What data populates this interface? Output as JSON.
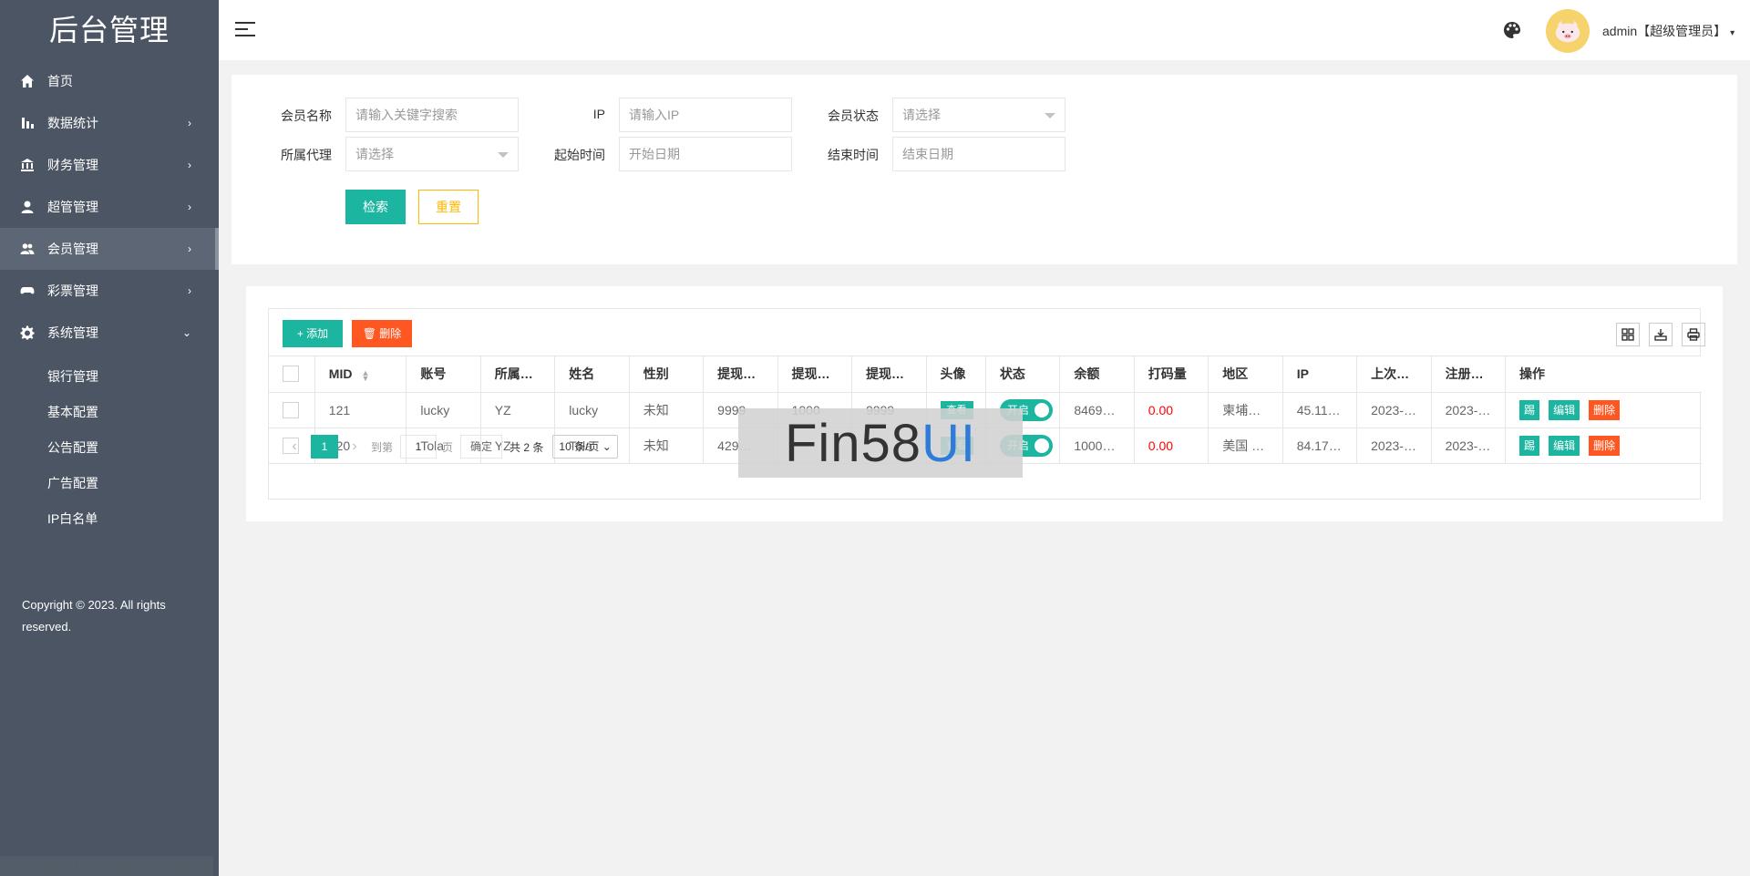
{
  "sidebar": {
    "title": "后台管理",
    "items": [
      {
        "label": "首页",
        "icon": "home-icon",
        "arrow": ""
      },
      {
        "label": "数据统计",
        "icon": "bar-chart-icon",
        "arrow": "›"
      },
      {
        "label": "财务管理",
        "icon": "bank-icon",
        "arrow": "›"
      },
      {
        "label": "超管管理",
        "icon": "user-icon",
        "arrow": "›"
      },
      {
        "label": "会员管理",
        "icon": "users-icon",
        "arrow": "›"
      },
      {
        "label": "彩票管理",
        "icon": "gamepad-icon",
        "arrow": "›"
      },
      {
        "label": "系统管理",
        "icon": "gear-icon",
        "arrow": "⌄"
      }
    ],
    "sub_items": [
      "银行管理",
      "基本配置",
      "公告配置",
      "广告配置",
      "IP白名单"
    ],
    "copyright": "Copyright © 2023. All rights reserved.",
    "status_url": "admincaperends.com/admin/homes/index"
  },
  "header": {
    "user": "admin【超级管理员】",
    "caret": "▾"
  },
  "search": {
    "member_name_label": "会员名称",
    "member_name_placeholder": "请输入关键字搜索",
    "ip_label": "IP",
    "ip_placeholder": "请输入IP",
    "status_label": "会员状态",
    "status_value": "请选择",
    "agent_label": "所属代理",
    "agent_value": "请选择",
    "start_label": "起始时间",
    "start_placeholder": "开始日期",
    "end_label": "结束时间",
    "end_placeholder": "结束日期",
    "search_button": "检索",
    "reset_button": "重置"
  },
  "toolbar": {
    "add_label": "+ 添加",
    "delete_label": "🗑 删除"
  },
  "table": {
    "headers": {
      "mid": "MID",
      "account": "账号",
      "agent": "所属…",
      "name": "姓名",
      "gender": "性别",
      "w1": "提现…",
      "w2": "提现…",
      "w3": "提现…",
      "avatar": "头像",
      "status": "状态",
      "balance": "余额",
      "code": "打码量",
      "region": "地区",
      "ip": "IP",
      "last": "上次…",
      "reg": "注册…",
      "ops": "操作"
    },
    "rows": [
      {
        "mid": "121",
        "account": "lucky",
        "agent": "YZ",
        "name": "lucky",
        "gender": "未知",
        "w1": "9999",
        "w2": "1000",
        "w3": "9999",
        "avatar": "查看",
        "status": "开启",
        "balance": "8469…",
        "code": "0.00",
        "region": "柬埔…",
        "ip": "45.11…",
        "last": "2023-…",
        "reg": "2023-…",
        "op1": "踢",
        "op2": "编辑",
        "op3": "删除"
      },
      {
        "mid": "120",
        "account": "Tola",
        "agent": "YZ",
        "name": "Tola",
        "gender": "未知",
        "w1": "429…",
        "w2": "",
        "w3": "",
        "avatar": "查看",
        "status": "开启",
        "balance": "1000…",
        "code": "0.00",
        "region": "美国 …",
        "ip": "84.17…",
        "last": "2023-…",
        "reg": "2023-…",
        "op1": "踢",
        "op2": "编辑",
        "op3": "删除"
      }
    ]
  },
  "pager": {
    "prev": "‹",
    "current": "1",
    "next": "›",
    "goto_label": "到第",
    "goto_value": "1",
    "page_unit": "页",
    "confirm": "确定",
    "total": "共 2 条",
    "page_size": "10 条/页"
  },
  "watermark": {
    "part1": "Fin58",
    "part2": "UI"
  },
  "colors": {
    "sidebar_bg": "#4b5563",
    "accent": "#1bb5a0",
    "danger": "#ff5722",
    "warning": "#ffb800"
  }
}
